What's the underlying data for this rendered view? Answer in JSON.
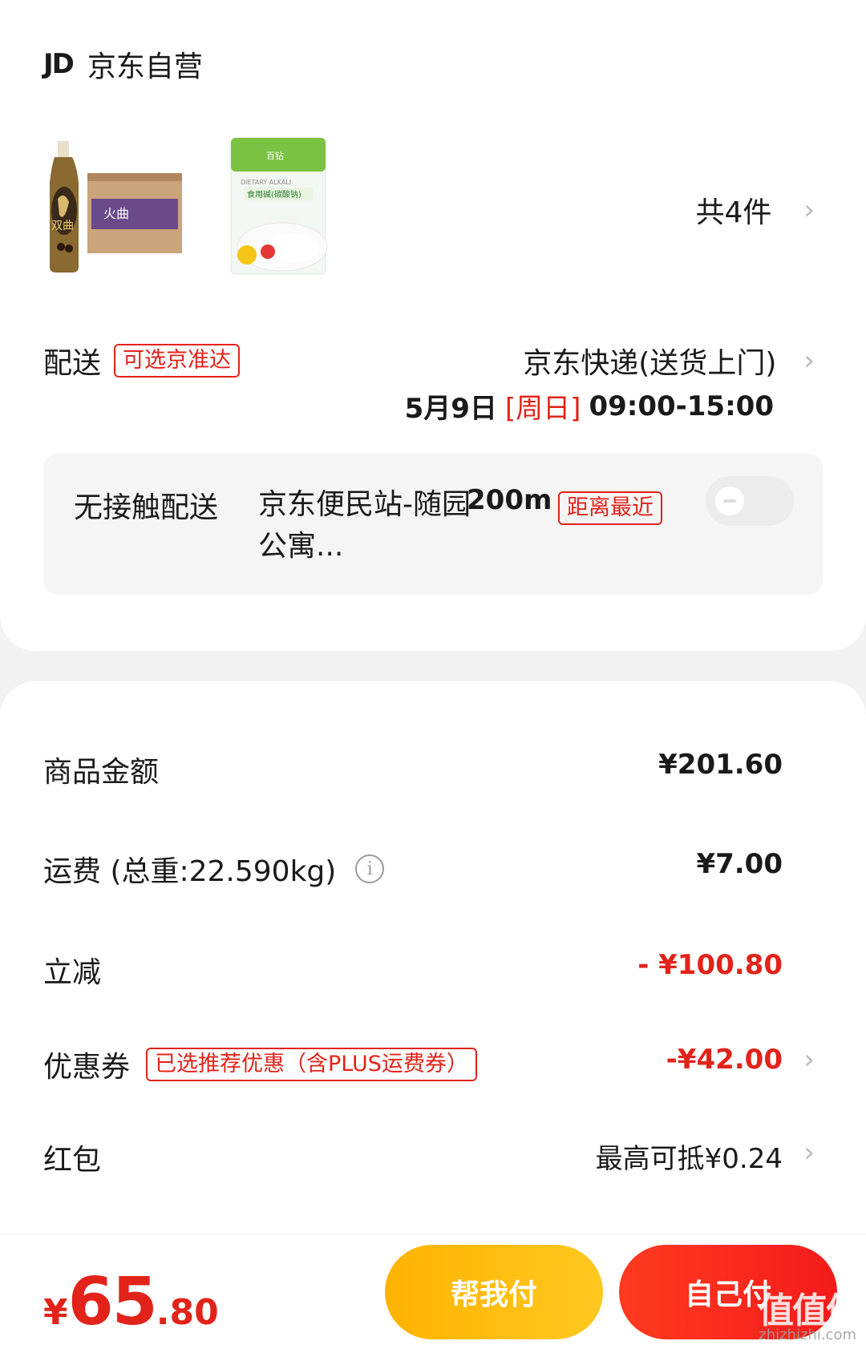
{
  "shop": {
    "logo": "JD",
    "name": "京东自营"
  },
  "products": {
    "item1_label": "双曲",
    "item2_label": "食用碱(碳酸钠)",
    "count_text": "共4件"
  },
  "delivery": {
    "label": "配送",
    "tag": "可选京准达",
    "method": "京东快递(送货上门)",
    "date": "5月9日",
    "day_of_week": "[周日]",
    "time_range": "09:00-15:00"
  },
  "contactless": {
    "title": "无接触配送",
    "station": "京东便民站-随园公寓...",
    "distance": "200m",
    "distance_tag": "距离最近",
    "toggle_on": false
  },
  "price": {
    "goods_label": "商品金额",
    "goods_value": "¥201.60",
    "shipping_label": "运费 (总重:22.590kg)",
    "shipping_value": "¥7.00",
    "discount_label": "立减",
    "discount_value": "- ¥100.80",
    "coupon_label": "优惠券",
    "coupon_tag": "已选推荐优惠（含PLUS运费券）",
    "coupon_value": "-¥42.00",
    "redpacket_label": "红包",
    "redpacket_value": "最高可抵¥0.24"
  },
  "footer": {
    "currency": "¥",
    "total_int": "65",
    "total_dec": ".80",
    "help_pay": "帮我付",
    "self_pay": "自己付",
    "watermark": "值值值",
    "watermark_sub": "zhizhizhi.com"
  },
  "colors": {
    "accent_red": "#e2231a",
    "button_yellow": "#ffb300",
    "button_red": "#f31b1b"
  }
}
